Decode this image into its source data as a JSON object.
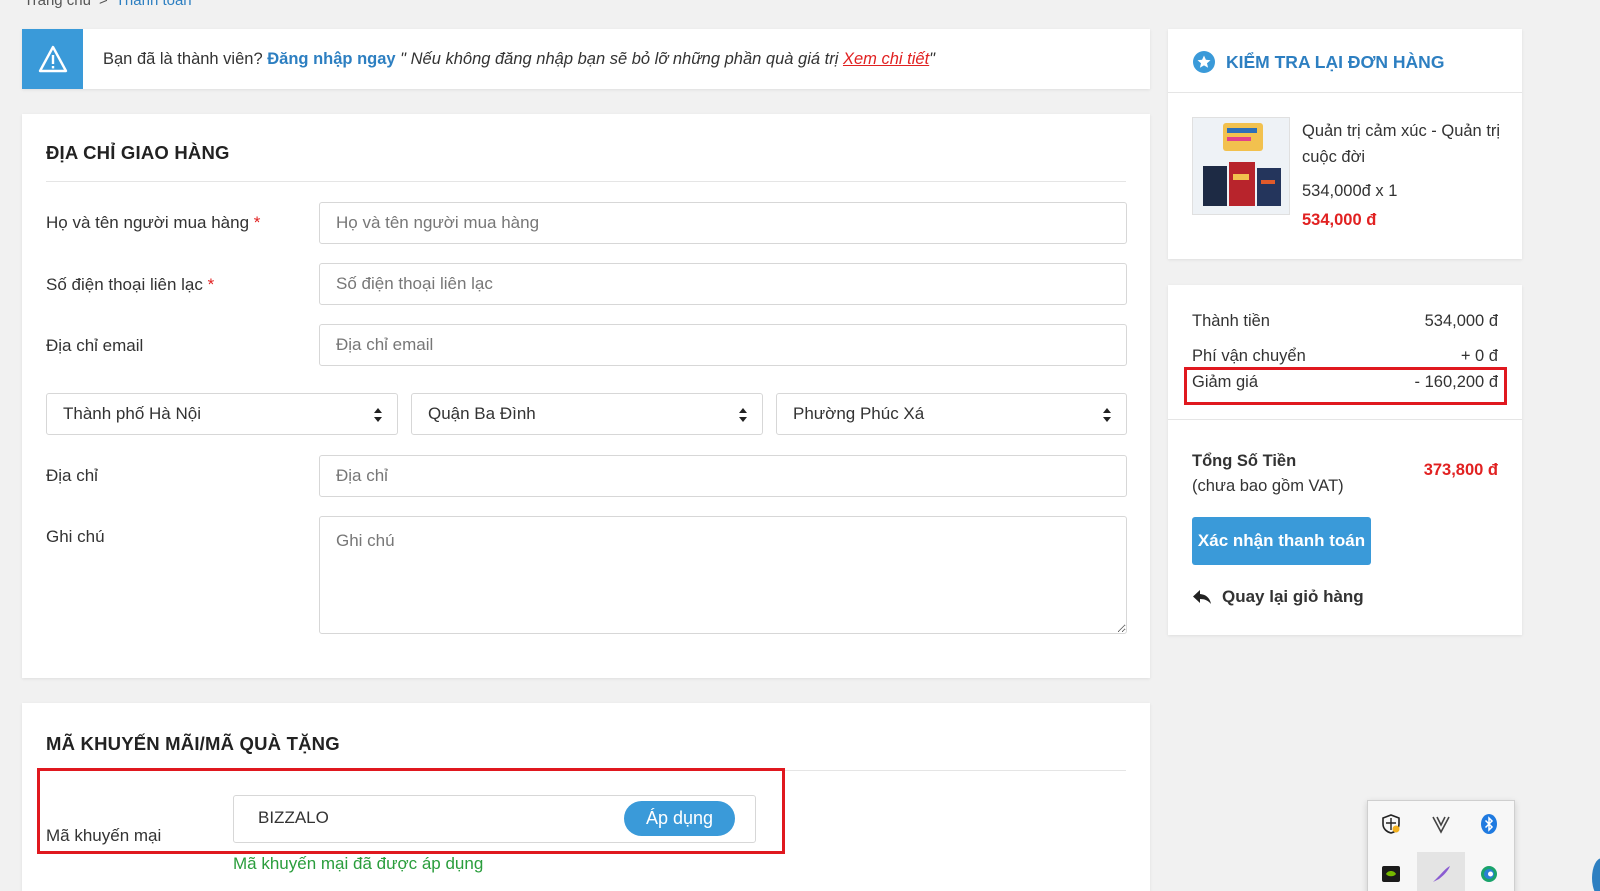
{
  "breadcrumb": {
    "home": "Trang chủ",
    "separator": ">",
    "current": "Thanh toán"
  },
  "notice": {
    "text_before": "Bạn đã là thành viên?",
    "login_link": "Đăng nhập ngay",
    "italic_text": "\" Nếu không đăng nhập bạn sẽ bỏ lỡ những phần quà giá trị",
    "detail_link": "Xem chi tiết",
    "closing_quote": "\""
  },
  "shipping": {
    "title": "ĐỊA CHỈ GIAO HÀNG",
    "name_label": "Họ và tên người mua hàng",
    "name_placeholder": "Họ và tên người mua hàng",
    "phone_label": "Số điện thoại liên lạc",
    "phone_placeholder": "Số điện thoại liên lạc",
    "email_label": "Địa chỉ email",
    "email_placeholder": "Địa chỉ email",
    "required_mark": "*",
    "city": "Thành phố Hà Nội",
    "district": "Quận Ba Đình",
    "ward": "Phường Phúc Xá",
    "address_label": "Địa chỉ",
    "address_placeholder": "Địa chỉ",
    "note_label": "Ghi chú",
    "note_placeholder": "Ghi chú"
  },
  "promo": {
    "title": "MÃ KHUYẾN MÃI/MÃ QUÀ TẶNG",
    "label": "Mã khuyến mại",
    "code": "BIZZALO",
    "apply_label": "Áp dụng",
    "success_message": "Mã khuyến mại đã được áp dụng"
  },
  "order": {
    "title": "KIỂM TRA LẠI ĐƠN HÀNG",
    "product_name": "Quản trị cảm xúc - Quản trị cuộc đời",
    "product_qty": "534,000đ x 1",
    "product_price": "534,000 đ"
  },
  "summary": {
    "subtotal_label": "Thành tiền",
    "subtotal_value": "534,000 đ",
    "shipping_label": "Phí vận chuyển",
    "shipping_value": "+ 0 đ",
    "discount_label": "Giảm giá",
    "discount_value": "- 160,200 đ",
    "total_label": "Tổng Số Tiền",
    "total_note": "(chưa bao gồm VAT)",
    "total_value": "373,800 đ",
    "confirm_label": "Xác nhận thanh toán",
    "back_label": "Quay lại giỏ hàng"
  },
  "colors": {
    "accent": "#3a9ad9",
    "price_red": "#e12121",
    "success_green": "#2a9d3c",
    "highlight_red": "#e0181f"
  },
  "icons": [
    "warning-icon",
    "star-badge-icon",
    "select-arrows-icon",
    "back-arrow-icon",
    "security-shield-icon",
    "vpn-icon",
    "bluetooth-icon",
    "nvidia-icon",
    "pen-icon",
    "edge-icon"
  ]
}
